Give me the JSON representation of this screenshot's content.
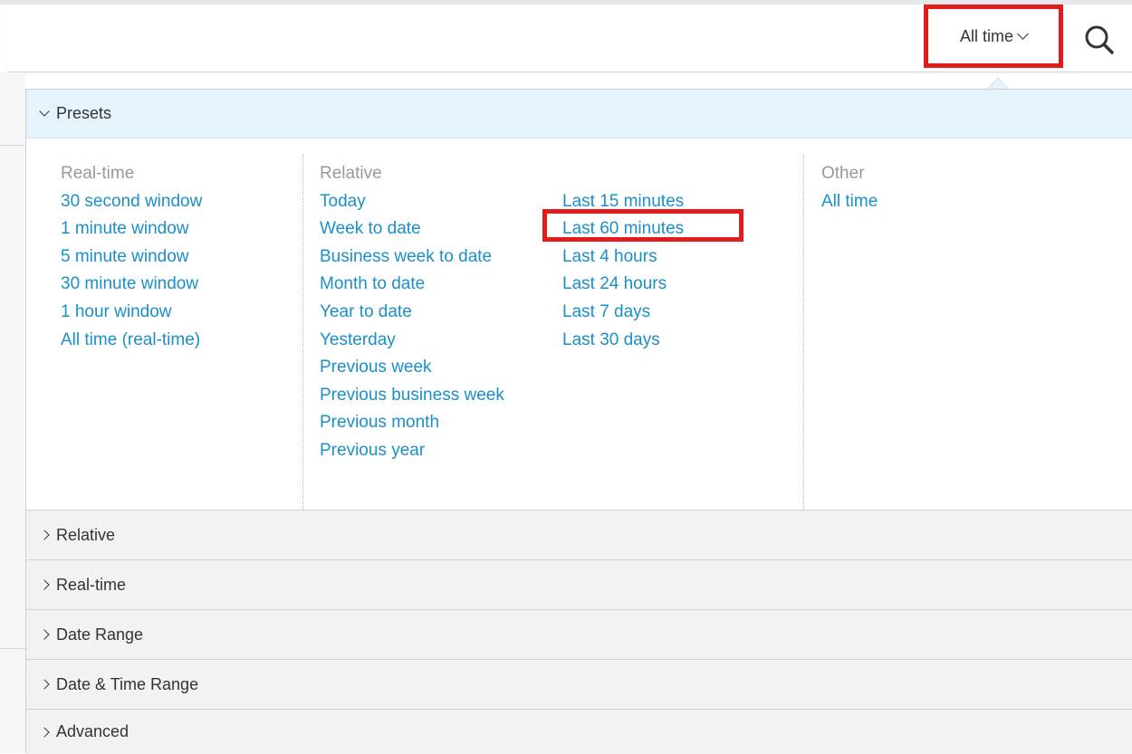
{
  "toolbar": {
    "time_label": "All time",
    "chevron_icon": "chevron-down-icon",
    "search_icon": "search-icon"
  },
  "presets": {
    "header": "Presets",
    "realtime": {
      "label": "Real-time",
      "items": [
        "30 second window",
        "1 minute window",
        "5 minute window",
        "30 minute window",
        "1 hour window",
        "All time (real-time)"
      ]
    },
    "relative": {
      "label": "Relative",
      "items_a": [
        "Today",
        "Week to date",
        "Business week to date",
        "Month to date",
        "Year to date",
        "Yesterday",
        "Previous week",
        "Previous business week",
        "Previous month",
        "Previous year"
      ],
      "items_b": [
        "Last 15 minutes",
        "Last 60 minutes",
        "Last 4 hours",
        "Last 24 hours",
        "Last 7 days",
        "Last 30 days"
      ]
    },
    "other": {
      "label": "Other",
      "items": [
        "All time"
      ]
    }
  },
  "sections": [
    "Relative",
    "Real-time",
    "Date Range",
    "Date & Time Range",
    "Advanced"
  ],
  "colors": {
    "link": "#1a8fc8",
    "highlight": "#e11c1c",
    "header_bg": "#e5f3fd"
  }
}
